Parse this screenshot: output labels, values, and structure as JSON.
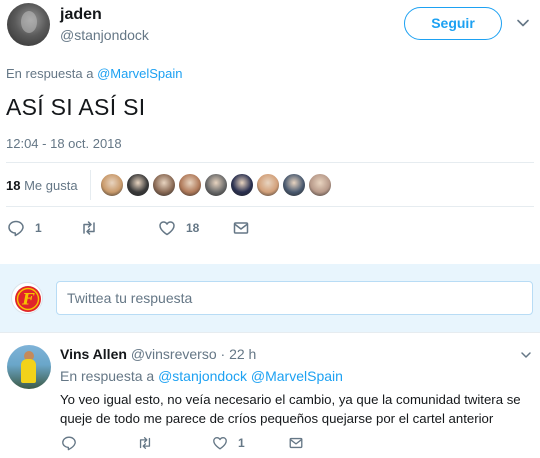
{
  "main_tweet": {
    "author_name": "jaden",
    "author_handle": "@stanjondock",
    "follow_label": "Seguir",
    "reply_prefix": "En respuesta a ",
    "reply_mention": "@MarvelSpain",
    "text": "ASÍ SI ASÍ SI",
    "timestamp": "12:04 - 18 oct. 2018",
    "likes_number": "18",
    "likes_label": "Me gusta",
    "liker_colors": [
      "#c99a6b",
      "#3a3a3a",
      "#8a6a55",
      "#b07a5a",
      "#6a6a6a",
      "#2a3050",
      "#d2a07a",
      "#4a5a70",
      "#b89a8a"
    ],
    "actions": {
      "reply_count": "1",
      "retweet_count": "",
      "like_count": "18"
    }
  },
  "composer": {
    "placeholder": "Twittea tu respuesta",
    "avatar_letter": "F",
    "avatar_color": "#e0242a"
  },
  "reply_tweet": {
    "author_name": "Vins Allen",
    "author_handle": "@vinsreverso",
    "separator": " · ",
    "time": "22 h",
    "reply_prefix": "En respuesta a ",
    "mention_1": "@stanjondock",
    "mention_2": "@MarvelSpain",
    "text": "Yo veo igual esto, no veía necesario el cambio, ya que la comunidad twitera se queje de todo me parece de críos pequeños quejarse por el cartel anterior",
    "actions": {
      "reply_count": "",
      "retweet_count": "",
      "like_count": "1"
    }
  },
  "colors": {
    "accent": "#1da1f2",
    "muted": "#657786",
    "text": "#14171a",
    "composer_bg": "#e8f5fd"
  }
}
